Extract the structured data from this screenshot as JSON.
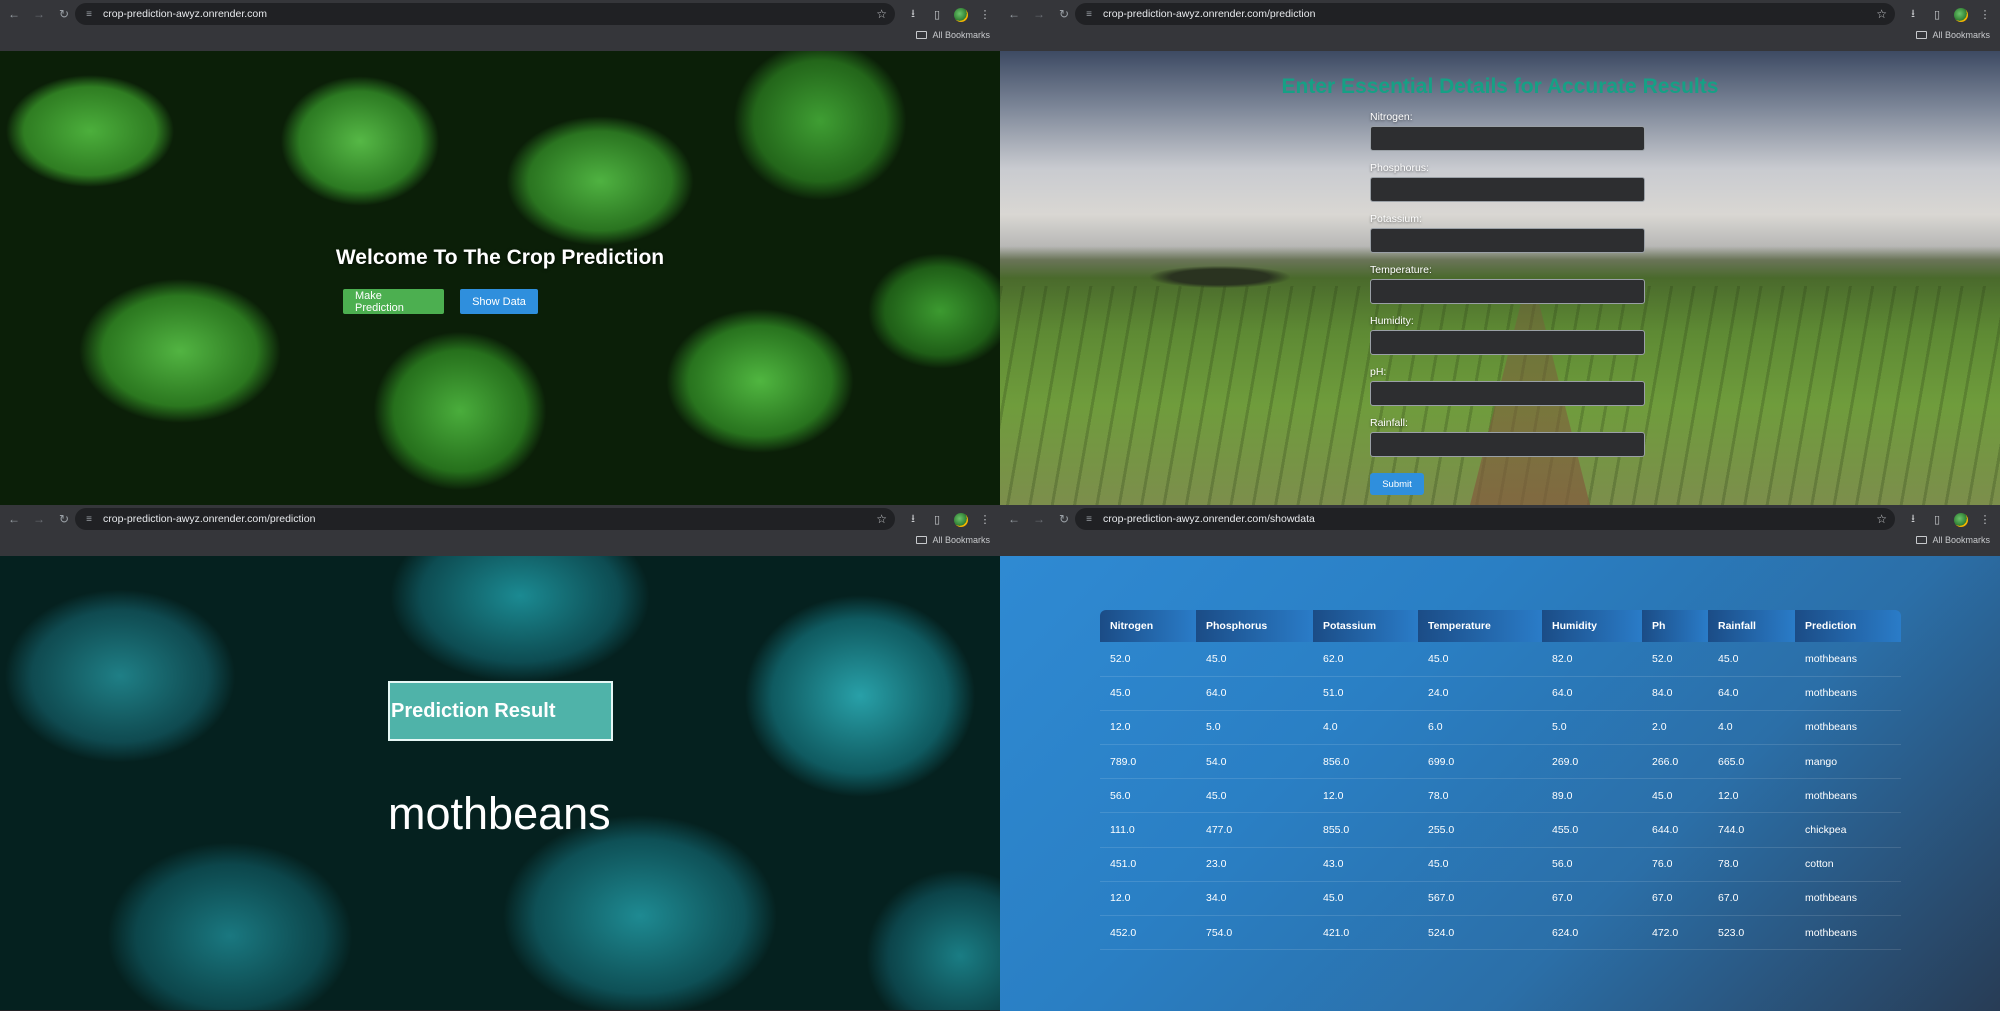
{
  "panes": {
    "top_left": {
      "url": "crop-prediction-awyz.onrender.com",
      "bookmarks_label": "All Bookmarks",
      "heading": "Welcome To The Crop Prediction",
      "make_prediction_label": "Make Prediction",
      "show_data_label": "Show Data"
    },
    "top_right": {
      "url": "crop-prediction-awyz.onrender.com/prediction",
      "bookmarks_label": "All Bookmarks",
      "title": "Enter Essential Details for Accurate Results",
      "fields": [
        {
          "label": "Nitrogen:",
          "value": ""
        },
        {
          "label": "Phosphorus:",
          "value": ""
        },
        {
          "label": "Potassium:",
          "value": ""
        },
        {
          "label": "Temperature:",
          "value": ""
        },
        {
          "label": "Humidity:",
          "value": ""
        },
        {
          "label": "pH:",
          "value": ""
        },
        {
          "label": "Rainfall:",
          "value": ""
        }
      ],
      "submit_label": "Submit"
    },
    "bottom_left": {
      "url": "crop-prediction-awyz.onrender.com/prediction",
      "bookmarks_label": "All Bookmarks",
      "result_heading": "Prediction Result",
      "result_value": "mothbeans"
    },
    "bottom_right": {
      "url": "crop-prediction-awyz.onrender.com/showdata",
      "bookmarks_label": "All Bookmarks",
      "table": {
        "headers": [
          "Nitrogen",
          "Phosphorus",
          "Potassium",
          "Temperature",
          "Humidity",
          "Ph",
          "Rainfall",
          "Prediction"
        ],
        "rows": [
          [
            "52.0",
            "45.0",
            "62.0",
            "45.0",
            "82.0",
            "52.0",
            "45.0",
            "mothbeans"
          ],
          [
            "45.0",
            "64.0",
            "51.0",
            "24.0",
            "64.0",
            "84.0",
            "64.0",
            "mothbeans"
          ],
          [
            "12.0",
            "5.0",
            "4.0",
            "6.0",
            "5.0",
            "2.0",
            "4.0",
            "mothbeans"
          ],
          [
            "789.0",
            "54.0",
            "856.0",
            "699.0",
            "269.0",
            "266.0",
            "665.0",
            "mango"
          ],
          [
            "56.0",
            "45.0",
            "12.0",
            "78.0",
            "89.0",
            "45.0",
            "12.0",
            "mothbeans"
          ],
          [
            "111.0",
            "477.0",
            "855.0",
            "255.0",
            "455.0",
            "644.0",
            "744.0",
            "chickpea"
          ],
          [
            "451.0",
            "23.0",
            "43.0",
            "45.0",
            "56.0",
            "76.0",
            "78.0",
            "cotton"
          ],
          [
            "12.0",
            "34.0",
            "45.0",
            "567.0",
            "67.0",
            "67.0",
            "67.0",
            "mothbeans"
          ],
          [
            "452.0",
            "754.0",
            "421.0",
            "524.0",
            "624.0",
            "472.0",
            "523.0",
            "mothbeans"
          ]
        ]
      }
    }
  },
  "colors": {
    "chrome_bg": "#35363a",
    "form_title": "#16a085",
    "btn_green": "#4caf50",
    "btn_blue": "#2f8fdd",
    "result_box": "#4fb3a9"
  },
  "icons": [
    "back-arrow-icon",
    "forward-arrow-icon",
    "reload-icon",
    "site-info-icon",
    "star-icon",
    "download-icon",
    "side-panel-icon",
    "profile-icon",
    "kebab-menu-icon",
    "folder-icon"
  ]
}
